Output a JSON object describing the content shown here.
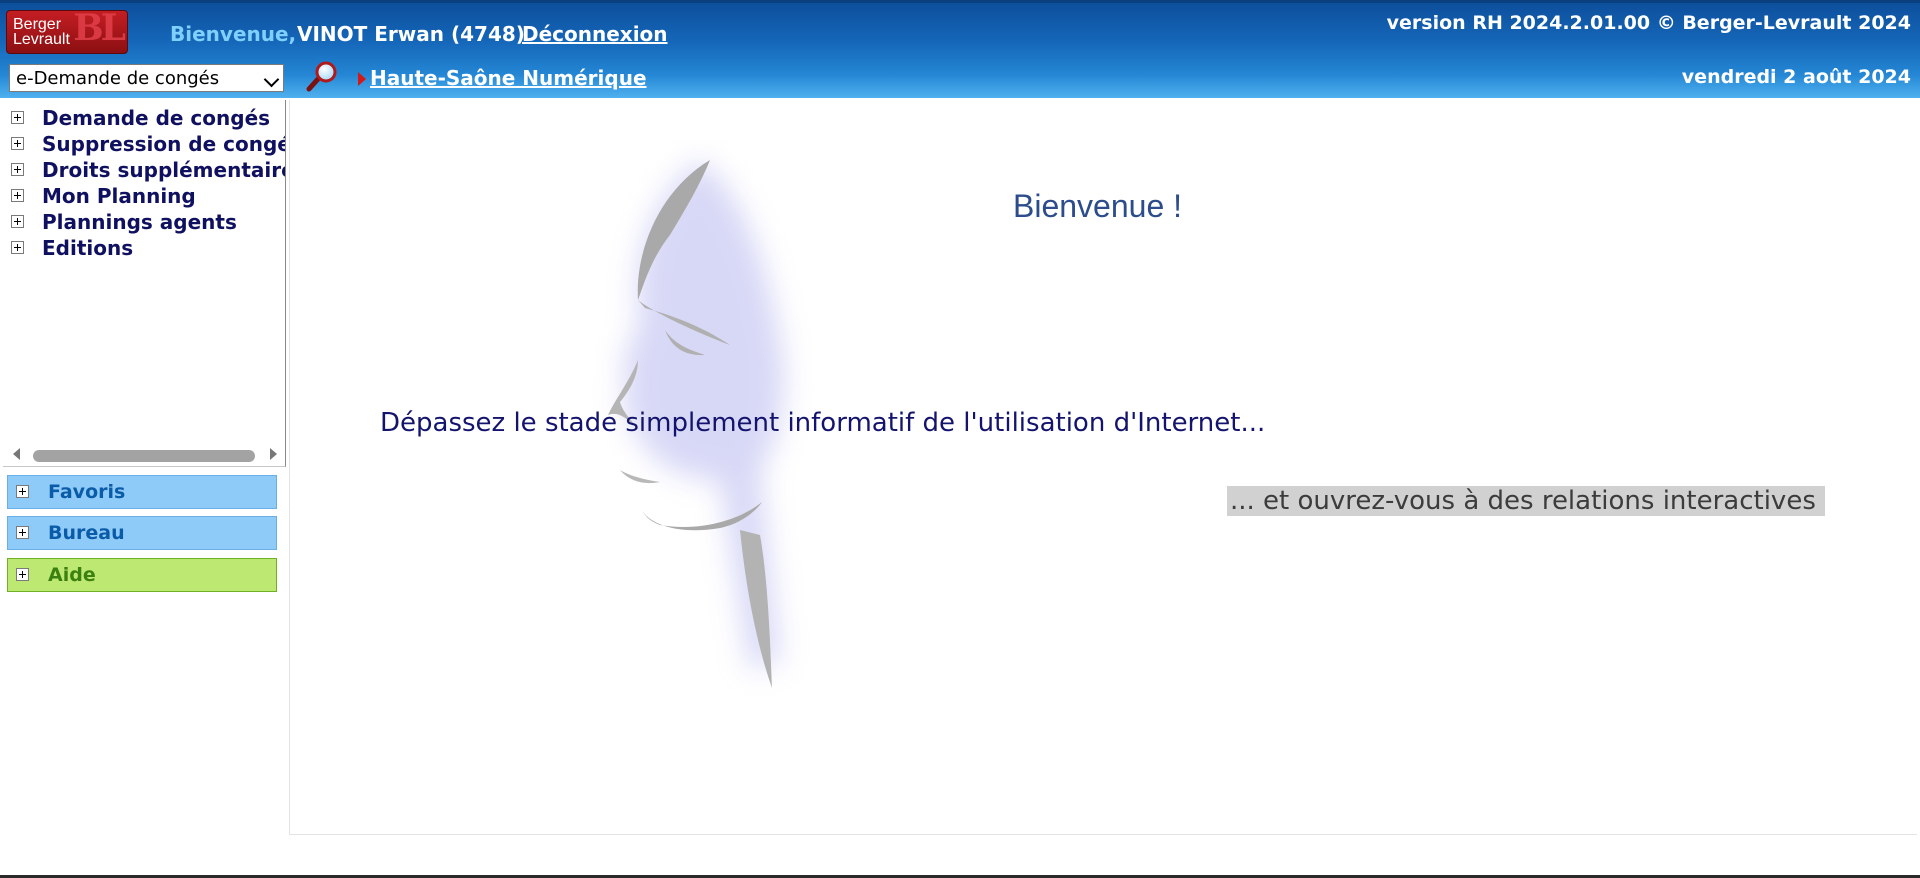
{
  "header": {
    "logo_word1": "Berger",
    "logo_word2": "Levrault",
    "logo_mark": "BL",
    "welcome_label": "Bienvenue,",
    "user_name": "VINOT Erwan (4748)",
    "logout_label": "Déconnexion",
    "version_text": "version RH 2024.2.01.00 © Berger-Levrault 2024",
    "date_text": "vendredi 2 août 2024",
    "module_select": {
      "selected": "e-Demande de congés"
    },
    "search_icon": "magnifier-icon",
    "organization_link": "Haute-Saône Numérique"
  },
  "tree": {
    "items": [
      {
        "label": "Demande de congés"
      },
      {
        "label": "Suppression de congés"
      },
      {
        "label": "Droits supplémentaires"
      },
      {
        "label": "Mon Planning"
      },
      {
        "label": "Plannings agents"
      },
      {
        "label": "Editions"
      }
    ]
  },
  "panels": [
    {
      "label": "Favoris",
      "color": "#8fcbf8"
    },
    {
      "label": "Bureau",
      "color": "#8fcbf8"
    },
    {
      "label": "Aide",
      "color": "#bde872"
    }
  ],
  "main": {
    "welcome": "Bienvenue !",
    "tagline": "Dépassez le stade simplement informatif de l'utilisation d'Internet...",
    "tagline2": "... et ouvrez-vous à des relations interactives"
  },
  "colors": {
    "header_top": "#0d4f9c",
    "header_bottom": "#4fb1ee",
    "tree_text": "#101060",
    "logo_red": "#c41e23"
  }
}
